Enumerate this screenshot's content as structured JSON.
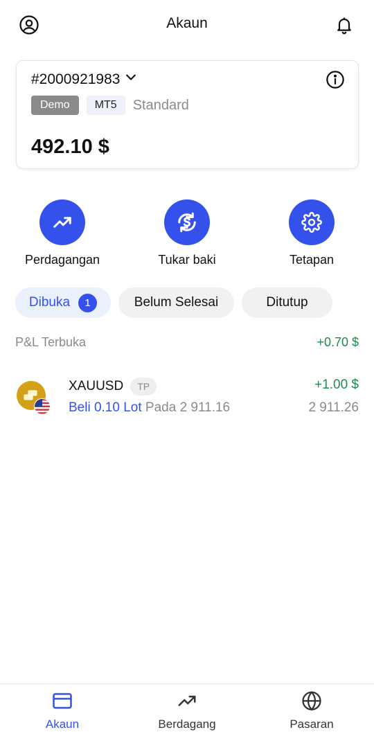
{
  "header": {
    "title": "Akaun",
    "profile_icon": "user-circle-icon",
    "bell_icon": "bell-icon"
  },
  "account": {
    "number": "#2000921983",
    "type_badge": "Demo",
    "platform_badge": "MT5",
    "account_class": "Standard",
    "balance": "492.10 $"
  },
  "actions": [
    {
      "label": "Perdagangan",
      "icon": "trending-up-icon"
    },
    {
      "label": "Tukar baki",
      "icon": "exchange-dollar-icon"
    },
    {
      "label": "Tetapan",
      "icon": "gear-icon"
    }
  ],
  "tabs": {
    "open_label": "Dibuka",
    "open_count": "1",
    "pending_label": "Belum Selesai",
    "closed_label": "Ditutup"
  },
  "pnl": {
    "label": "P&L Terbuka",
    "value": "+0.70 $"
  },
  "position": {
    "symbol": "XAUUSD",
    "tag": "TP",
    "side_lot": "Beli 0.10 Lot",
    "open_text": "Pada 2 911.16",
    "profit": "+1.00 $",
    "current_price": "2 911.26"
  },
  "nav": [
    {
      "label": "Akaun",
      "icon": "card-icon",
      "active": true
    },
    {
      "label": "Berdagang",
      "icon": "trending-up-icon",
      "active": false
    },
    {
      "label": "Pasaran",
      "icon": "globe-icon",
      "active": false
    }
  ],
  "colors": {
    "accent": "#3451ec",
    "positive": "#1e8a4c",
    "muted": "#8a8a8a"
  }
}
